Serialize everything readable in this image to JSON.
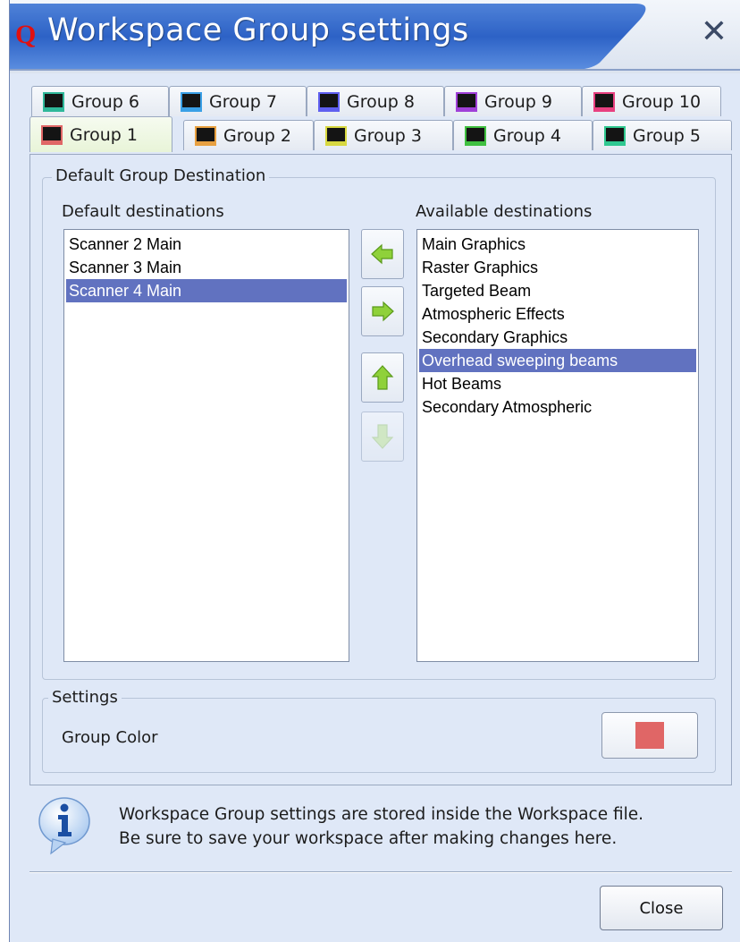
{
  "window": {
    "title": "Workspace Group settings",
    "app_icon": "Q",
    "close_glyph": "✕"
  },
  "tabs_row_back": [
    {
      "label": "Group 6",
      "color": "#2fb89a"
    },
    {
      "label": "Group 7",
      "color": "#3aa0e6"
    },
    {
      "label": "Group 8",
      "color": "#6060f0"
    },
    {
      "label": "Group 9",
      "color": "#a040d8"
    },
    {
      "label": "Group 10",
      "color": "#e84080"
    }
  ],
  "tabs_row_front": [
    {
      "label": "Group 1",
      "color": "#e06666",
      "active": true
    },
    {
      "label": "Group 2",
      "color": "#e8a040"
    },
    {
      "label": "Group 3",
      "color": "#d8d840"
    },
    {
      "label": "Group 4",
      "color": "#40c040"
    },
    {
      "label": "Group 5",
      "color": "#30c890"
    }
  ],
  "destination": {
    "group_title": "Default Group Destination",
    "default_label": "Default destinations",
    "available_label": "Available destinations",
    "default_items": [
      "Scanner 2 Main",
      "Scanner 3 Main",
      "Scanner 4 Main"
    ],
    "default_selected_index": 2,
    "available_items": [
      "Main Graphics",
      "Raster Graphics",
      "Targeted Beam",
      "Atmospheric Effects",
      "Secondary Graphics",
      "Overhead sweeping beams",
      "Hot Beams",
      "Secondary Atmospheric"
    ],
    "available_selected_index": 5
  },
  "settings": {
    "group_title": "Settings",
    "color_label": "Group Color",
    "color_value": "#e06666"
  },
  "info": {
    "line1": "Workspace Group settings are stored inside the Workspace file.",
    "line2": "Be sure to save your workspace after making changes here."
  },
  "close_label": "Close",
  "icons": {
    "move_left": "arrow-left-icon",
    "move_right": "arrow-right-icon",
    "move_up": "arrow-up-icon",
    "move_down": "arrow-down-icon",
    "info": "info-icon"
  }
}
